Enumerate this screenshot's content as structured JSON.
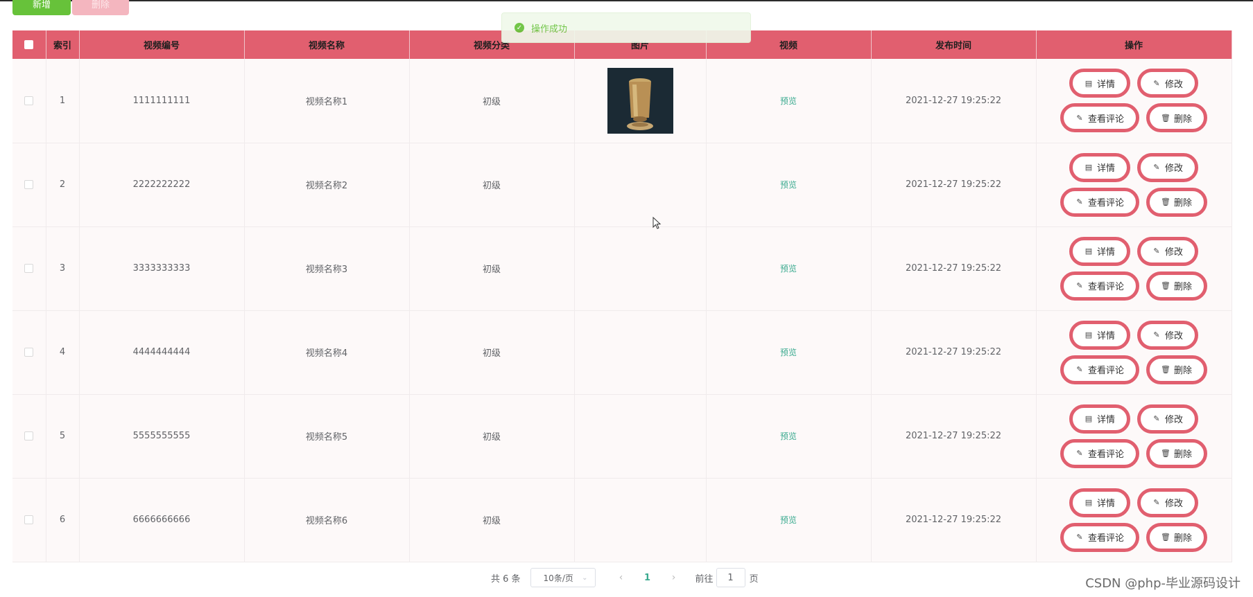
{
  "toolbar": {
    "add_label": "新增",
    "delete_label": "删除"
  },
  "toast": {
    "message": "操作成功"
  },
  "table": {
    "headers": [
      "索引",
      "视频编号",
      "视频名称",
      "视频分类",
      "图片",
      "视频",
      "发布时间",
      "操作"
    ],
    "rows": [
      {
        "index": "1",
        "code": "1111111111",
        "name": "视频名称1",
        "category": "初级",
        "video": "预览",
        "time": "2021-12-27 19:25:22"
      },
      {
        "index": "2",
        "code": "2222222222",
        "name": "视频名称2",
        "category": "初级",
        "video": "预览",
        "time": "2021-12-27 19:25:22"
      },
      {
        "index": "3",
        "code": "3333333333",
        "name": "视频名称3",
        "category": "初级",
        "video": "预览",
        "time": "2021-12-27 19:25:22"
      },
      {
        "index": "4",
        "code": "4444444444",
        "name": "视频名称4",
        "category": "初级",
        "video": "预览",
        "time": "2021-12-27 19:25:22"
      },
      {
        "index": "5",
        "code": "5555555555",
        "name": "视频名称5",
        "category": "初级",
        "video": "预览",
        "time": "2021-12-27 19:25:22"
      },
      {
        "index": "6",
        "code": "6666666666",
        "name": "视频名称6",
        "category": "初级",
        "video": "预览",
        "time": "2021-12-27 19:25:22"
      }
    ],
    "actions": {
      "detail": "详情",
      "edit": "修改",
      "comments": "查看评论",
      "delete": "删除"
    }
  },
  "pagination": {
    "total": "共 6 条",
    "page_size": "10条/页",
    "current": "1",
    "goto": "前往",
    "goto_value": "1",
    "page_unit": "页"
  },
  "watermark": "CSDN @php-毕业源码设计",
  "colors": {
    "header": "#e15f6f",
    "success": "#67c23a",
    "link": "#3aaa8f"
  }
}
